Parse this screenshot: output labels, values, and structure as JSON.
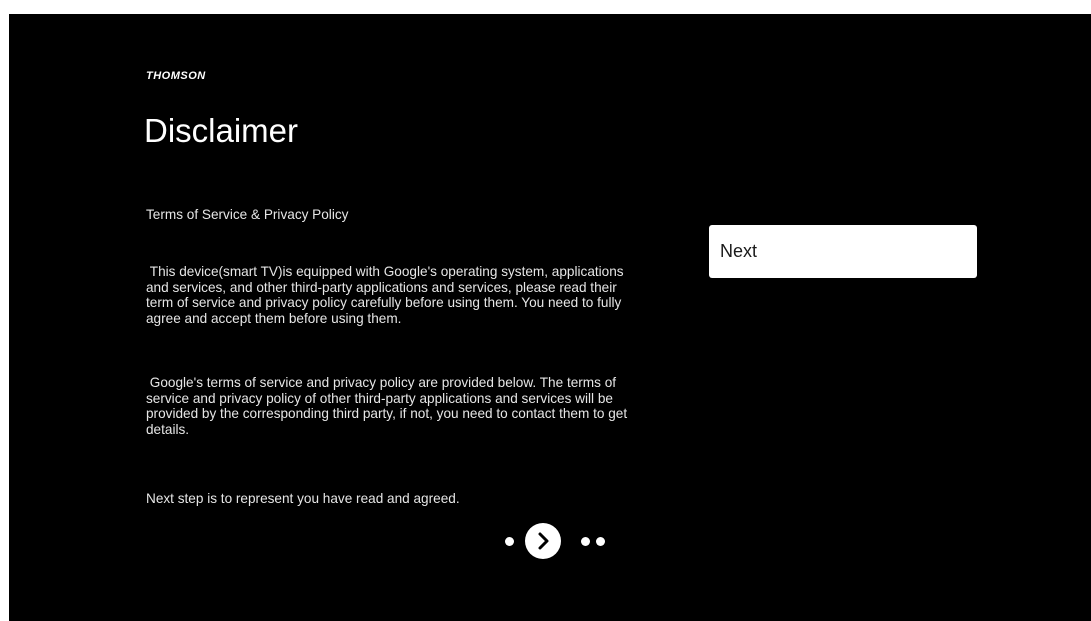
{
  "brand": "THOMSON",
  "page": {
    "title": "Disclaimer",
    "subtitle": "Terms of Service & Privacy Policy",
    "paragraph1": "This device(smart TV)is equipped with Google's operating system, applications and services, and other third-party applications and services, please read their term of service and privacy policy carefully before using them. You need to fully agree and accept them before using them.",
    "paragraph2": "Google's terms of service and privacy policy are provided below. The terms of service and privacy policy of other third-party applications and services will be provided by the corresponding third party, if not, you need to contact them to get details.",
    "paragraph3": "Next step is to represent you have read and agreed."
  },
  "actions": {
    "next_label": "Next"
  },
  "pager": {
    "icon": "chevron-right-icon",
    "current_step": 2,
    "total_steps": 4
  },
  "colors": {
    "background": "#000000",
    "text": "#ffffff",
    "button_bg": "#ffffff",
    "button_text": "#1a1a1a"
  }
}
